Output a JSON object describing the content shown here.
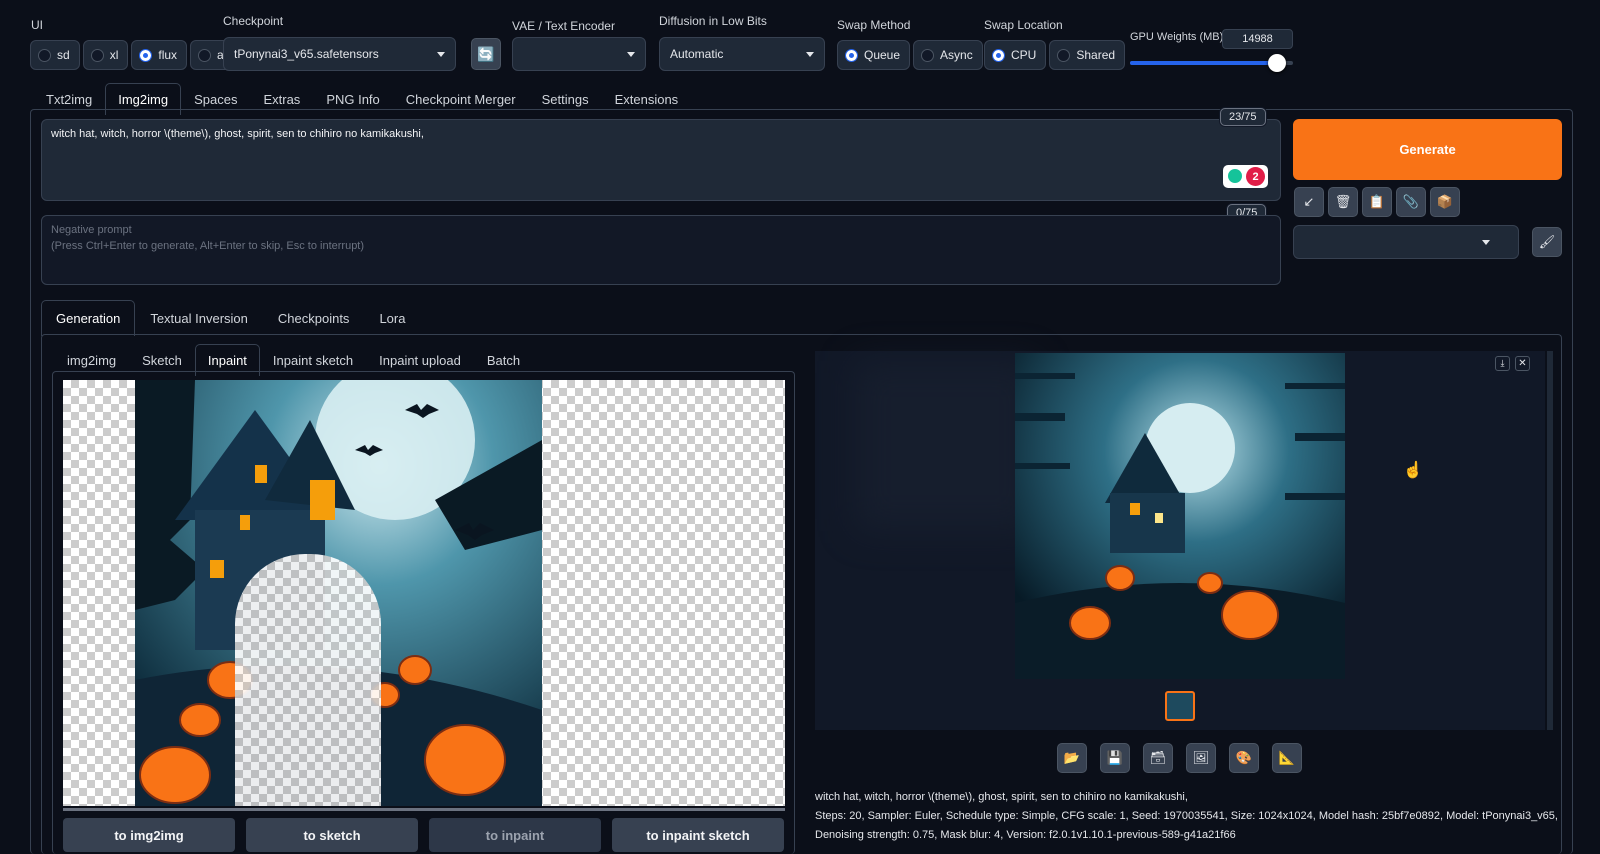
{
  "top": {
    "ui_label": "UI",
    "ui_options": [
      {
        "label": "sd",
        "selected": false
      },
      {
        "label": "xl",
        "selected": false
      },
      {
        "label": "flux",
        "selected": true
      },
      {
        "label": "all",
        "selected": false
      }
    ],
    "checkpoint_label": "Checkpoint",
    "checkpoint_value": "tPonynai3_v65.safetensors",
    "refresh_icon": "refresh-icon",
    "vae_label": "VAE / Text Encoder",
    "vae_value": "",
    "diffusion_label": "Diffusion in Low Bits",
    "diffusion_value": "Automatic",
    "swap_method_label": "Swap Method",
    "swap_method_options": [
      {
        "label": "Queue",
        "selected": true
      },
      {
        "label": "Async",
        "selected": false
      }
    ],
    "swap_location_label": "Swap Location",
    "swap_location_options": [
      {
        "label": "CPU",
        "selected": true
      },
      {
        "label": "Shared",
        "selected": false
      }
    ],
    "gpu_label": "GPU Weights (MB)",
    "gpu_value": "14988",
    "gpu_slider_fraction": 0.9
  },
  "main_tabs": [
    "Txt2img",
    "Img2img",
    "Spaces",
    "Extras",
    "PNG Info",
    "Checkpoint Merger",
    "Settings",
    "Extensions"
  ],
  "prompt": {
    "text": "witch hat, witch,  horror \\(theme\\), ghost, spirit, sen to chihiro no kamikakushi,",
    "counter": "23/75",
    "badge_count": "2",
    "negative_label": "Negative prompt",
    "negative_hint": "(Press Ctrl+Enter to generate, Alt+Enter to skip, Esc to interrupt)",
    "negative_counter": "0/75"
  },
  "generate": {
    "label": "Generate",
    "accent": "#f97316",
    "tool_icons": [
      "arrow-icon",
      "trash-icon",
      "clipboard-icon",
      "paperclip-icon",
      "box-icon"
    ],
    "styles_value": "",
    "brush_icon": "brush-icon"
  },
  "sub_tabs": [
    "Generation",
    "Textual Inversion",
    "Checkpoints",
    "Lora"
  ],
  "mode_tabs": [
    "img2img",
    "Sketch",
    "Inpaint",
    "Inpaint sketch",
    "Inpaint upload",
    "Batch"
  ],
  "bottom_buttons": [
    "to img2img",
    "to sketch",
    "to inpaint",
    "to inpaint sketch"
  ],
  "output": {
    "tool_icons": [
      "folder-icon",
      "save-icon",
      "zip-icon",
      "image-icon",
      "palette-icon",
      "ruler-icon"
    ],
    "info_line1": "witch hat, witch, horror \\(theme\\), ghost, spirit, sen to chihiro no kamikakushi,",
    "info_line2": "Steps: 20, Sampler: Euler, Schedule type: Simple, CFG scale: 1, Seed: 1970035541, Size: 1024x1024, Model hash: 25bf7e0892, Model: tPonynai3_v65,",
    "info_line3": "Denoising strength: 0.75, Mask blur: 4, Version: f2.0.1v1.10.1-previous-589-g41a21f66"
  }
}
